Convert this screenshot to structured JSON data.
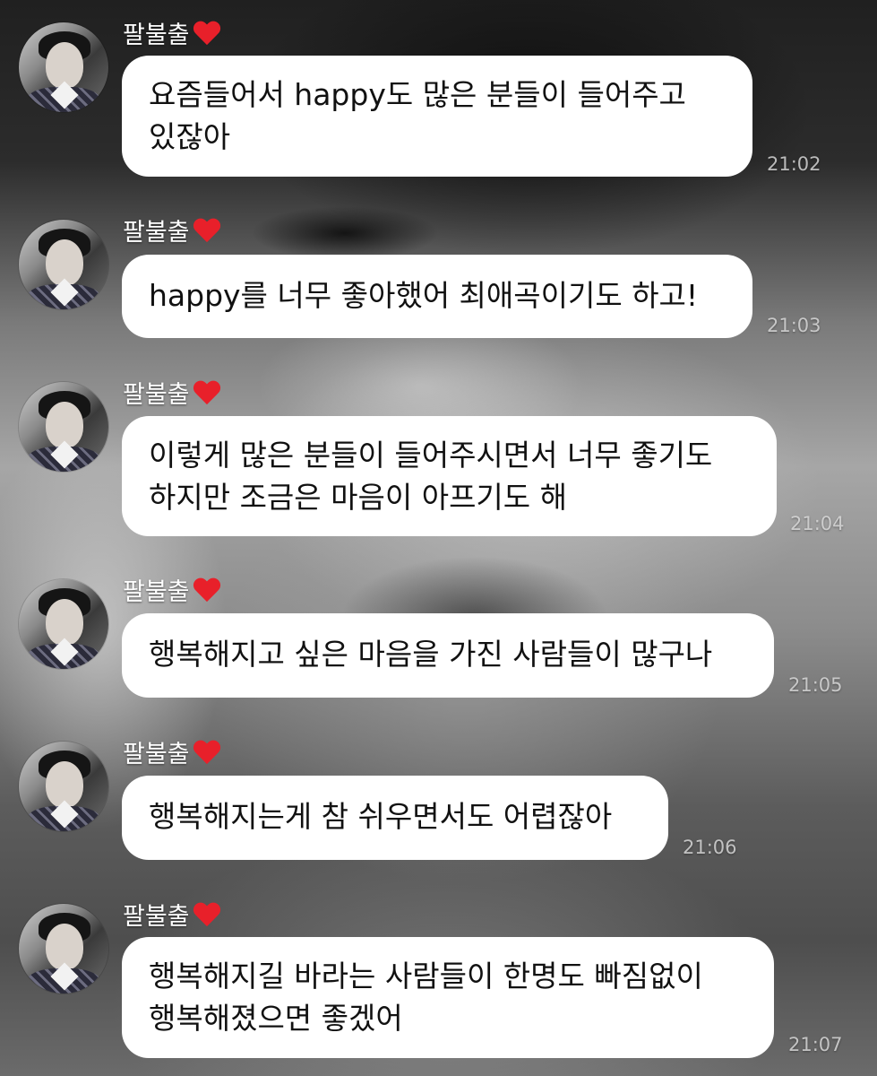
{
  "chat": {
    "sender": "팔불출",
    "messages": [
      {
        "lines": [
          "요즘들어서 happy도 많은 분들이 들어주고",
          "있잖아"
        ],
        "time": "21:02"
      },
      {
        "lines": [
          "happy를 너무 좋아했어 최애곡이기도 하고!"
        ],
        "time": "21:03"
      },
      {
        "lines": [
          "이렇게 많은 분들이 들어주시면서 너무 좋기도",
          "하지만 조금은 마음이 아프기도 해"
        ],
        "time": "21:04"
      },
      {
        "lines": [
          "행복해지고 싶은 마음을 가진 사람들이 많구나"
        ],
        "time": "21:05"
      },
      {
        "lines": [
          "행복해지는게 참 쉬우면서도 어렵잖아"
        ],
        "time": "21:06"
      },
      {
        "lines": [
          "행복해지길 바라는 사람들이 한명도 빠짐없이",
          "행복해졌으면 좋겠어"
        ],
        "time": "21:07"
      }
    ]
  },
  "icons": {
    "heart": "heart-icon",
    "heart_color": "#e8202a"
  }
}
